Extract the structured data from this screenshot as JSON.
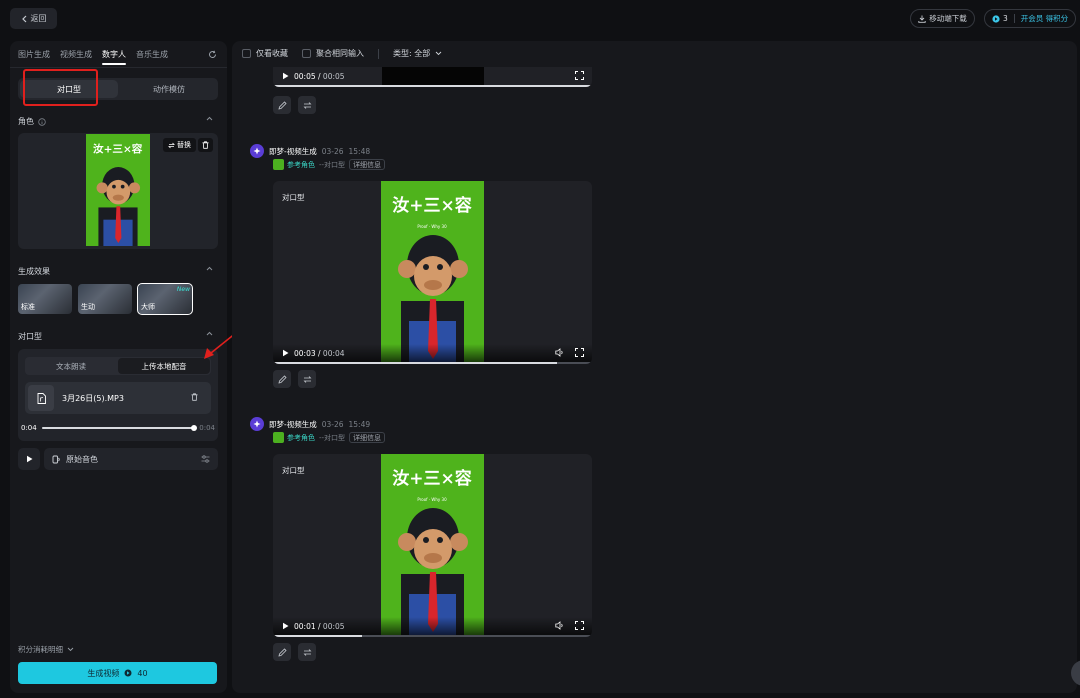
{
  "topbar": {
    "back_label": "返回",
    "mobile_download_label": "移动端下载",
    "credits_count": "3",
    "vip_label": "开会员 得积分"
  },
  "left": {
    "tabs": [
      "图片生成",
      "视频生成",
      "数字人",
      "音乐生成"
    ],
    "active_tab": "数字人",
    "mode_options": [
      "对口型",
      "动作模仿"
    ],
    "role_title": "角色",
    "replace_label": "替换",
    "effect_title": "生成效果",
    "effects": [
      {
        "label": "标准",
        "badge": ""
      },
      {
        "label": "生动",
        "badge": ""
      },
      {
        "label": "大师",
        "badge": "New"
      }
    ],
    "lip_title": "对口型",
    "lip_tabs": [
      "文本朗读",
      "上传本地配音"
    ],
    "file_name": "3月26日(5).MP3",
    "audio_start": "0:04",
    "audio_end": "0:04",
    "audio_progress": 1.0,
    "voice_label": "原始音色",
    "cost_label": "积分消耗明细",
    "generate_label": "生成视频",
    "generate_cost": "40"
  },
  "right": {
    "filters": {
      "favorites_label": "仅看收藏",
      "merge_label": "聚合相同输入",
      "type_label": "类型: 全部"
    },
    "top_video": {
      "time_current": "00:05",
      "time_total": "00:05",
      "progress": 1.0
    },
    "items": [
      {
        "source": "即梦-视频生成",
        "date": "03-26",
        "time": "15:48",
        "ref_label": "参考角色",
        "mode": "--对口型",
        "detail_label": "详细信息",
        "video_tag": "对口型",
        "time_current": "00:03",
        "time_total": "00:04",
        "progress": 0.89
      },
      {
        "source": "即梦-视频生成",
        "date": "03-26",
        "time": "15:49",
        "ref_label": "参考角色",
        "mode": "--对口型",
        "detail_label": "详细信息",
        "video_tag": "对口型",
        "time_current": "00:01",
        "time_total": "00:05",
        "progress": 0.28
      }
    ]
  },
  "poster": {
    "title": "汝+三×容",
    "subtitle": "Proof · Why 30",
    "colors": {
      "bg": "#4fb31c",
      "suit": "#2c4fa5",
      "tie": "#d9262c",
      "sweater": "#1a1c22"
    }
  },
  "colors": {
    "accent": "#1ec8e0",
    "highlight_box": "#e0201d",
    "brand_purple": "#5a3dd6",
    "teal": "#3bd6c6"
  }
}
